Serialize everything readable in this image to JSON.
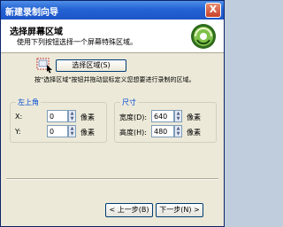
{
  "window": {
    "title": "新建录制向导",
    "close_glyph": "X"
  },
  "header": {
    "title": "选择屏幕区域",
    "subtitle": "使用下列按钮选择一个屏幕特殊区域。"
  },
  "select_button": {
    "label": "选择区域(S)"
  },
  "instruction": "按\"选择区域\"按钮并拖动鼠标定义您想要进行录制的区域。",
  "top_left": {
    "title": "左上角",
    "x_label": "X:",
    "x_value": "0",
    "x_unit": "像素",
    "y_label": "Y:",
    "y_value": "0",
    "y_unit": "像素"
  },
  "size": {
    "title": "尺寸",
    "width_label": "宽度(D):",
    "width_value": "640",
    "width_unit": "像素",
    "height_label": "高度(H):",
    "height_value": "480",
    "height_unit": "像素"
  },
  "buttons": {
    "back": "< 上一步(B)",
    "next": "下一步(N) >"
  },
  "spin_glyphs": {
    "up": "▲",
    "down": "▼"
  },
  "colors": {
    "titlebar": "#2463d4",
    "group_title": "#0046d5",
    "background": "#ece9d8"
  }
}
